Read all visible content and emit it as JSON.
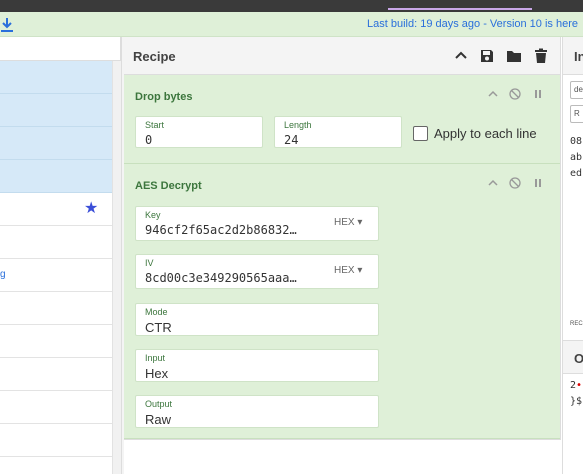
{
  "banner": {
    "build_text": "Last build: 19 days ago",
    "version_text": " - Version 10 is here"
  },
  "icons": {
    "download": "download-icon",
    "star": "star-icon",
    "chevron_up": "chevron-up-icon",
    "save": "save-icon",
    "folder": "folder-icon",
    "trash": "trash-icon",
    "disable": "disable-icon",
    "pause": "pause-icon"
  },
  "colors": {
    "banner_bg": "#dff0d8",
    "op_bg": "#dff0d8",
    "op_title": "#3c763d",
    "link": "#2a6fdb",
    "highlight": "#d6e9f8"
  },
  "operations": {
    "fragment_text": "g"
  },
  "recipe": {
    "title": "Recipe",
    "ops": [
      {
        "title": "Drop bytes",
        "fields": {
          "start_label": "Start",
          "start_value": "0",
          "length_label": "Length",
          "length_value": "24",
          "apply_label": "Apply to each line"
        }
      },
      {
        "title": "AES Decrypt",
        "fields": {
          "key_label": "Key",
          "key_value": "946cf2f65ac2d2b86832…",
          "key_format": "HEX",
          "iv_label": "IV",
          "iv_value": "8cd00c3e349290565aaa…",
          "iv_format": "HEX",
          "mode_label": "Mode",
          "mode_value": "CTR",
          "input_label": "Input",
          "input_value": "Hex",
          "output_label": "Output",
          "output_value": "Raw"
        }
      }
    ]
  },
  "io": {
    "input_title": "In",
    "mini1": "de",
    "mini2": "R",
    "input_text_1": "08",
    "input_text_2": "ab",
    "input_text_3": "ed",
    "tiny_label": "REC",
    "output_title": "O",
    "output_text_1a": "2",
    "output_text_1b": "•",
    "output_text_2": "}$"
  }
}
